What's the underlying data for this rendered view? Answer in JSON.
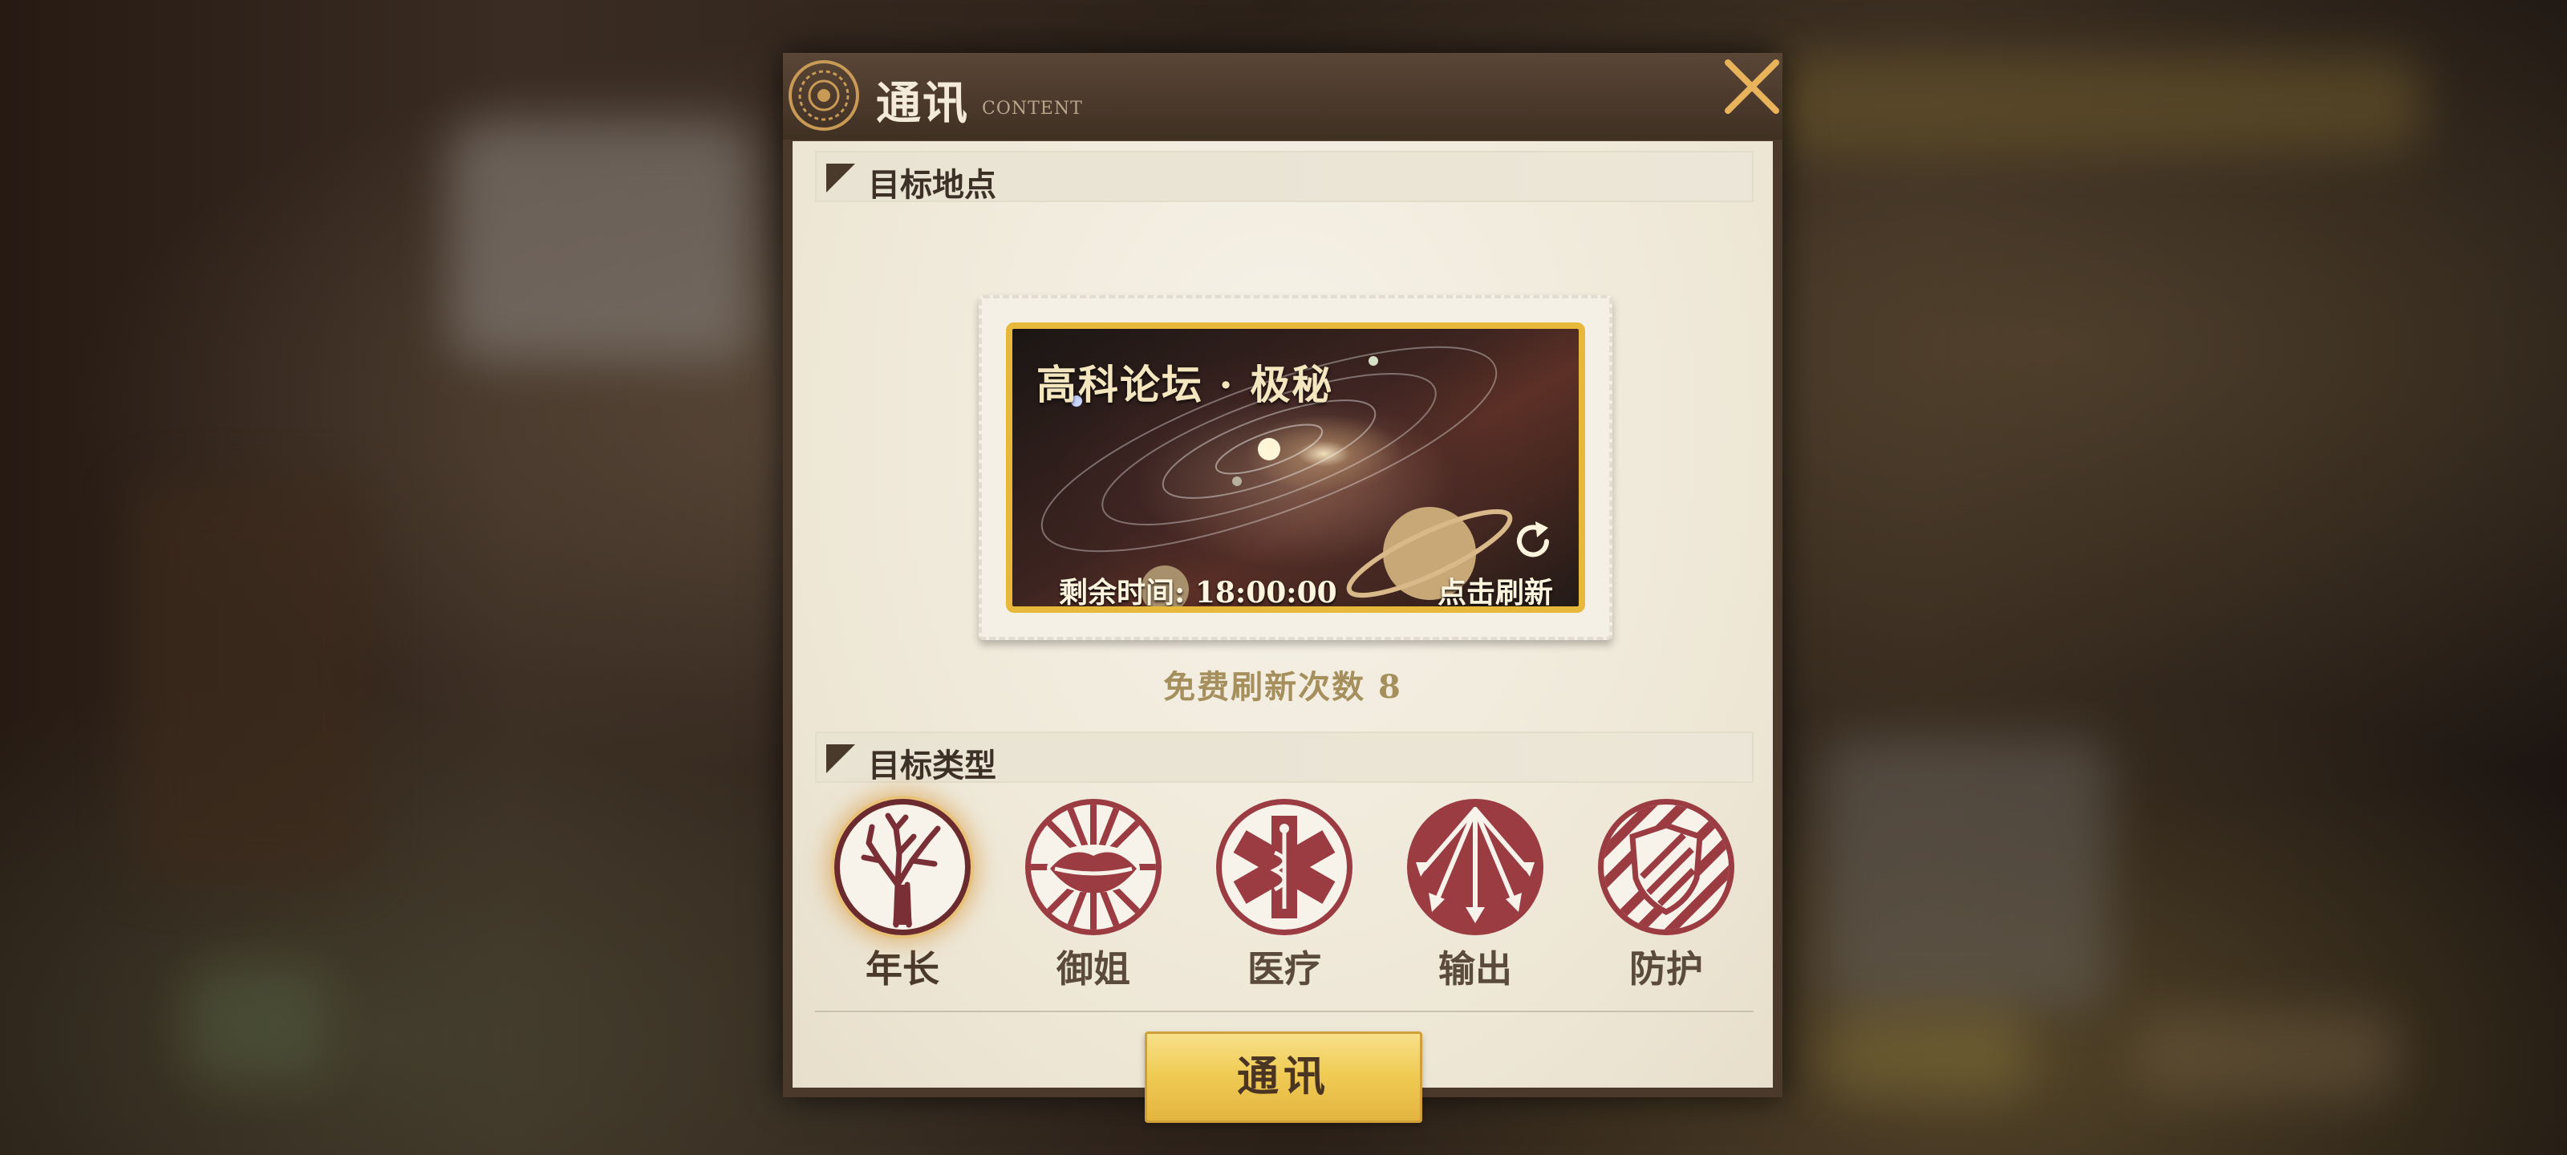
{
  "dialog": {
    "title": "通讯",
    "subtitle": "CONTENT",
    "close_icon": "close-x-icon"
  },
  "target_location": {
    "header": "目标地点",
    "card": {
      "title": "高科论坛 · 极秘",
      "remaining_time": "剩余时间: 18:00:00",
      "refresh_label": "点击刷新",
      "refresh_icon": "refresh-icon"
    },
    "free_refresh": "免费刷新次数 8"
  },
  "target_type": {
    "header": "目标类型",
    "options": [
      {
        "label": "年长",
        "icon": "tree-icon",
        "selected": true
      },
      {
        "label": "御姐",
        "icon": "lips-icon",
        "selected": false
      },
      {
        "label": "医疗",
        "icon": "medical-cross-icon",
        "selected": false
      },
      {
        "label": "输出",
        "icon": "arrows-icon",
        "selected": false
      },
      {
        "label": "防护",
        "icon": "shield-icon",
        "selected": false
      }
    ]
  },
  "action_button": "通讯",
  "colors": {
    "accent_gold": "#e7b83a",
    "icon_red": "#9b3b42",
    "panel_bg": "#f2ede2",
    "title_bar": "#4b3a2c"
  }
}
